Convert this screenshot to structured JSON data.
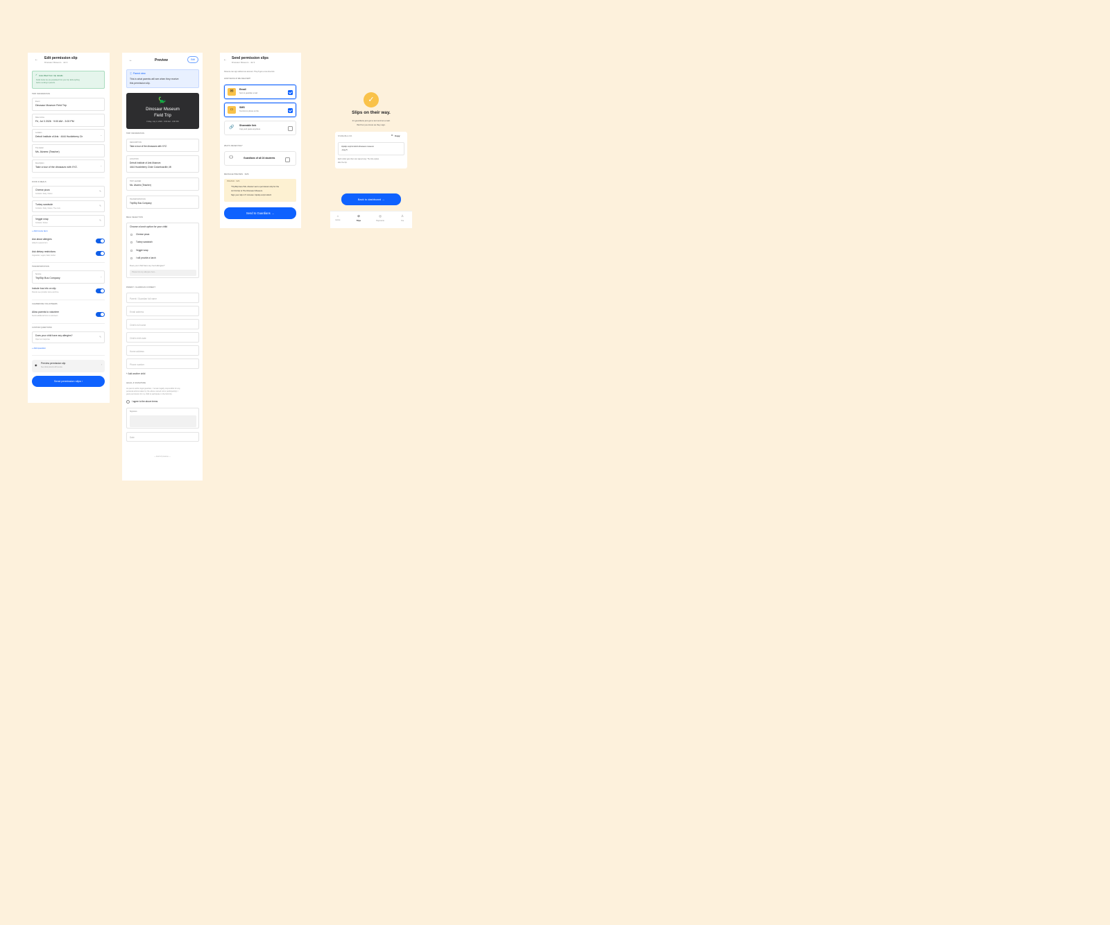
{
  "edit": {
    "title": "Edit permission slip",
    "subtitle": "Dinosaur Museum · Jul 3",
    "autofill": {
      "title": "Auto-filled from trip details",
      "body1": "Fields below are pre-populated from your trip. Edit anything",
      "body2": "before sending to parents."
    },
    "section_trip": "TRIP INFORMATION",
    "fields": [
      {
        "label": "Event",
        "value": "Dinosaur Museum Field Trip"
      },
      {
        "label": "Date & time",
        "value": "Fri, Jul 3 2026 · 9:00 AM - 3:00 PM"
      },
      {
        "label": "Location",
        "value": "Detroit Institute of Arts · 4444 Huckleberry Cir"
      },
      {
        "label": "Trip leader",
        "value": "Ms. Alvarez (Teacher)"
      },
      {
        "label": "Description",
        "value": "Take a tour of the dinosaurs with XYZ."
      }
    ],
    "section_food": "FOOD & MEALS",
    "menu": [
      {
        "name": "Cheese pizza",
        "detail": "Contains: Dairy, Gluten"
      },
      {
        "name": "Turkey sandwich",
        "detail": "Contains: Dairy, Gluten, Tree nuts"
      },
      {
        "name": "Veggie wrap",
        "detail": "Contains: Gluten"
      }
    ],
    "add_menu": "+ Add menu item",
    "allergies": {
      "label": "Ask about allergies",
      "detail": "Added to parent form"
    },
    "dietary": {
      "label": "Ask dietary restrictions",
      "detail": "Vegetarian, vegan, halal, kosher"
    },
    "section_transport": "TRANSPORTATION",
    "service": {
      "label": "Service",
      "value": "TripSlip Bus Company"
    },
    "bus": {
      "label": "Include bus info on slip",
      "detail": "Parents see provider name and time"
    },
    "section_chaperone": "CHAPERONE VOLUNTEERS",
    "volunteer": {
      "label": "Allow parents to volunteer",
      "detail": "Sends additional form to volunteers"
    },
    "section_custom": "CUSTOM QUESTIONS",
    "question": {
      "label": "Does your child have any allergies?",
      "detail": "Open text response"
    },
    "add_question": "+ Add question",
    "preview": {
      "label": "Preview permission slip",
      "detail": "See what parents will receive"
    },
    "send": "Send permission slips ›"
  },
  "preview": {
    "title": "Preview",
    "edit": "Edit",
    "banner_title": "Parent view",
    "banner_body1": "This is what parents will see when they receive",
    "banner_body2": "this permission slip.",
    "hero_title1": "Dinosaur Museum",
    "hero_title2": "Field Trip",
    "hero_date": "Friday, July 3, 2026 · 9:00 AM - 3:00 PM",
    "section_trip": "TRIP INFORMATION",
    "info": [
      {
        "label": "DESCRIPTION",
        "value": "Take a tour of the dinosaurs with XYZ.",
        "value2": ""
      },
      {
        "label": "LOCATION",
        "value": "Detroit Institute of Arts Museum",
        "value2": "4444 Huckleberry Circle Columbusville, MI"
      },
      {
        "label": "TRIP LEADER",
        "value": "Ms. Alvarez (Teacher)",
        "value2": ""
      },
      {
        "label": "TRANSPORTATION",
        "value": "TripSlip Bus Company",
        "value2": ""
      }
    ],
    "section_meal": "MEAL SELECTION",
    "meal_prompt": "Choose a lunch option for your child",
    "meal_options": [
      "Cheese pizza",
      "Turkey sandwich",
      "Veggie wrap",
      "I will provide a lunch"
    ],
    "allergy_q": "Does your child have any food allergies?",
    "allergy_ph": "Please list any allergies here...",
    "section_consent": "PARENT / GUARDIAN CONSENT",
    "consent_fields": [
      "Parent / Guardian full name",
      "Email address",
      "Child's full name",
      "Child's birth date",
      "Home address",
      "Phone number"
    ],
    "add_child": "+ Add another child",
    "section_legal": "LEGAL & SIGNATURE",
    "legal1": "As parent and/or legal guardian, I remain legally responsible for any",
    "legal2": "personal actions taken by the above named minor participant(s). I",
    "legal3": "grant permission for my child to participate in the field trip.",
    "agree": "I agree to the above terms",
    "signature": "Signature",
    "date": "Date",
    "end": "— End of preview —"
  },
  "send": {
    "title": "Send permission slips",
    "subtitle": "Dinosaur Museum · Jul 3",
    "intro": "Parents can sign without an account. They'll get a one-time link.",
    "section_delivery": "HOW SHOULD WE DELIVER?",
    "options": [
      {
        "name": "Email",
        "detail": "Sent to guardian email"
      },
      {
        "name": "SMS",
        "detail": "Text link to phone on file"
      },
      {
        "name": "Shareable link",
        "detail": "Copy and paste anywhere"
      }
    ],
    "section_recipients": "WHO'S RECEIVING?",
    "recipients": "Guardians of all 24 students",
    "section_message": "MESSAGE PREVIEW · SMS",
    "message_tag": "PREVIEW · SMS",
    "message1": "\"TripSlip here! Ms. Alvarez sent a permission slip for the",
    "message2": "Jul 3rd trip to The Dinosaur Museum.",
    "message3": "Sign your slip in 5 minutes: tripslip.co/p/m1Hx3",
    "send_button": "Send to Guardians →"
  },
  "success": {
    "title": "Slips on their way.",
    "body1": "21 guardians just got a text and an email.",
    "body2": "We'll let you know as they sign.",
    "link_label": "SHAREABLE LINK",
    "copy": "Copy",
    "link1": "tripslip.co/p/m1Hx3-dinosaur-museum",
    "link2": "-may-5",
    "note1": "Each visitor gets their own signed copy. The link expires",
    "note2": "after the trip.",
    "back": "Back to dashboard →",
    "tabs": [
      "Home",
      "Trips",
      "Payments",
      "You"
    ],
    "active_tab": "Trips"
  },
  "colors": {
    "background": "#fdf1dc",
    "accent": "#0f62fe",
    "yellow": "#f9c24a",
    "green": "#e5f5ec"
  }
}
